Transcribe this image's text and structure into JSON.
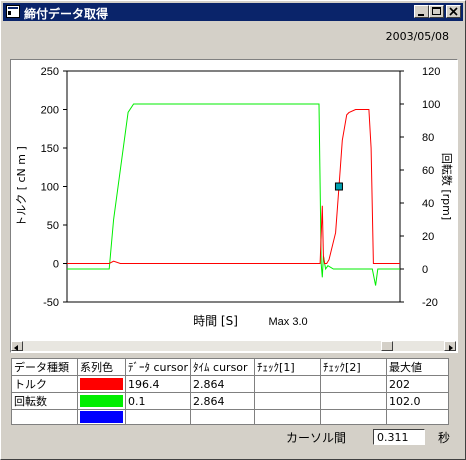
{
  "window": {
    "title": "締付データ取得",
    "buttons": [
      "minimize",
      "maximize",
      "close"
    ]
  },
  "date": "2003/05/08",
  "chart_data": {
    "type": "line",
    "xlabel": "時間 [S]",
    "xnote": "Max 3.0",
    "y_left": {
      "label": "トルク [ cN m ]",
      "lim": [
        -50,
        250
      ],
      "ticks": [
        -50,
        0,
        50,
        100,
        150,
        200,
        250
      ]
    },
    "y_right": {
      "label": "回転数 [rpm]",
      "lim": [
        -20,
        120
      ],
      "ticks": [
        -20,
        0,
        20,
        40,
        60,
        80,
        100,
        120
      ]
    },
    "xlim": [
      0,
      3.0
    ],
    "series": [
      {
        "name": "トルク",
        "color": "#ff0000",
        "axis": "left",
        "x": [
          0,
          0.25,
          0.38,
          0.42,
          0.48,
          1.5,
          2.2,
          2.28,
          2.3,
          2.31,
          2.32,
          2.34,
          2.36,
          2.42,
          2.45,
          2.48,
          2.52,
          2.54,
          2.6,
          2.64,
          2.66,
          2.69,
          2.72,
          2.74,
          2.76,
          2.78,
          2.8,
          3.0
        ],
        "y": [
          0,
          0,
          0,
          3,
          0,
          0,
          0,
          0,
          75,
          10,
          0,
          0,
          5,
          40,
          100,
          160,
          193,
          196,
          200,
          200,
          200,
          200,
          200,
          150,
          0,
          0,
          0,
          0
        ]
      },
      {
        "name": "回転数",
        "color": "#00ee00",
        "axis": "right",
        "x": [
          0,
          0.38,
          0.42,
          0.55,
          0.6,
          1.0,
          1.5,
          2.0,
          2.24,
          2.27,
          2.29,
          2.3,
          2.31,
          2.33,
          2.35,
          2.4,
          2.45,
          2.75,
          2.78,
          2.8,
          2.82,
          2.85,
          3.0
        ],
        "y": [
          0,
          0,
          30,
          95,
          100,
          100,
          100,
          100,
          100,
          100,
          3,
          -5,
          8,
          0,
          2,
          0,
          0,
          0,
          -10,
          0,
          0,
          0,
          0
        ]
      }
    ],
    "cursor": {
      "x": 2.45,
      "marker": "square"
    }
  },
  "table": {
    "headers": [
      "データ種類",
      "系列色",
      "ﾃﾞｰﾀ cursor",
      "ﾀｲﾑ cursor",
      "ﾁｪｯｸ[1]",
      "ﾁｪｯｸ[2]",
      "最大値"
    ],
    "rows": [
      {
        "name": "トルク",
        "color": "#ff0000",
        "data_cursor": "196.4",
        "time_cursor": "2.864",
        "check1": "",
        "check2": "",
        "max": "202"
      },
      {
        "name": "回転数",
        "color": "#00ee00",
        "data_cursor": "0.1",
        "time_cursor": "2.864",
        "check1": "",
        "check2": "",
        "max": "102.0"
      },
      {
        "name": "",
        "color": "#0000ff",
        "data_cursor": "",
        "time_cursor": "",
        "check1": "",
        "check2": "",
        "max": ""
      }
    ]
  },
  "cursor_interval": {
    "label": "カーソル間",
    "value": "0.311",
    "unit": "秒"
  }
}
